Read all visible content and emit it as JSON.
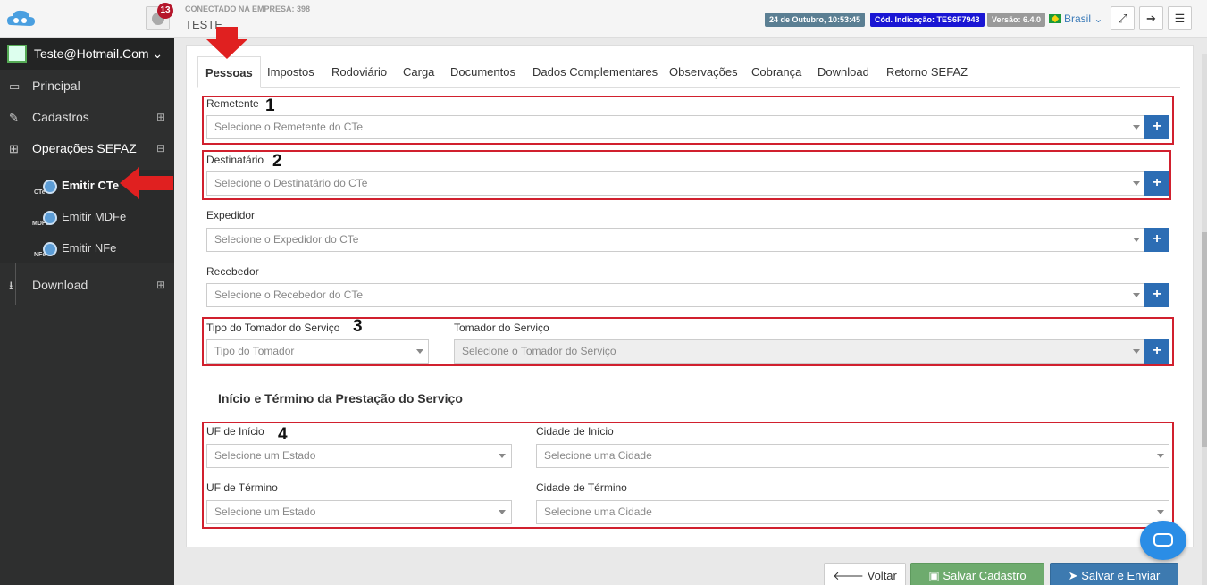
{
  "topbar": {
    "notif_count": "13",
    "company_label": "CONECTADO NA EMPRESA: 398",
    "company_name": "TESTE",
    "date": "24 de Outubro, 10:53:45",
    "indicacao": "Cód. Indicação: TES6F7943",
    "versao": "Versão: 6.4.0",
    "lang": "Brasil"
  },
  "sidebar": {
    "user": "Teste@Hotmail.Com",
    "items": [
      {
        "label": "Principal"
      },
      {
        "label": "Cadastros"
      },
      {
        "label": "Operações SEFAZ"
      },
      {
        "label": "Download"
      }
    ],
    "subitems": [
      {
        "label": "Emitir CTe",
        "tag": "CTe"
      },
      {
        "label": "Emitir MDFe",
        "tag": "MDFe"
      },
      {
        "label": "Emitir NFe",
        "tag": "NFe"
      }
    ]
  },
  "tabs": [
    "Pessoas",
    "Impostos",
    "Rodoviário",
    "Carga",
    "Documentos",
    "Dados Complementares",
    "Observações",
    "Cobrança",
    "Download",
    "Retorno SEFAZ"
  ],
  "form": {
    "remetente": {
      "label": "Remetente",
      "placeholder": "Selecione o Remetente do CTe"
    },
    "destinatario": {
      "label": "Destinatário",
      "placeholder": "Selecione o Destinatário do CTe"
    },
    "expedidor": {
      "label": "Expedidor",
      "placeholder": "Selecione o Expedidor do CTe"
    },
    "recebedor": {
      "label": "Recebedor",
      "placeholder": "Selecione o Recebedor do CTe"
    },
    "tipo_tomador": {
      "label": "Tipo do Tomador do Serviço",
      "placeholder": "Tipo do Tomador"
    },
    "tomador": {
      "label": "Tomador do Serviço",
      "placeholder": "Selecione o Tomador do Serviço"
    },
    "section_title": "Início e Término da Prestação do Serviço",
    "uf_inicio": {
      "label": "UF de Início",
      "placeholder": "Selecione um Estado"
    },
    "cidade_inicio": {
      "label": "Cidade de Início",
      "placeholder": "Selecione uma Cidade"
    },
    "uf_termino": {
      "label": "UF de Término",
      "placeholder": "Selecione um Estado"
    },
    "cidade_termino": {
      "label": "Cidade de Término",
      "placeholder": "Selecione uma Cidade"
    }
  },
  "annotations": [
    "1",
    "2",
    "3",
    "4"
  ],
  "footer": {
    "back": "Voltar",
    "save": "Salvar Cadastro",
    "send": "Salvar e Enviar"
  },
  "colors": {
    "accent": "#2c6db4",
    "annotation": "#d1202e",
    "sidebar": "#2e2f2f"
  }
}
